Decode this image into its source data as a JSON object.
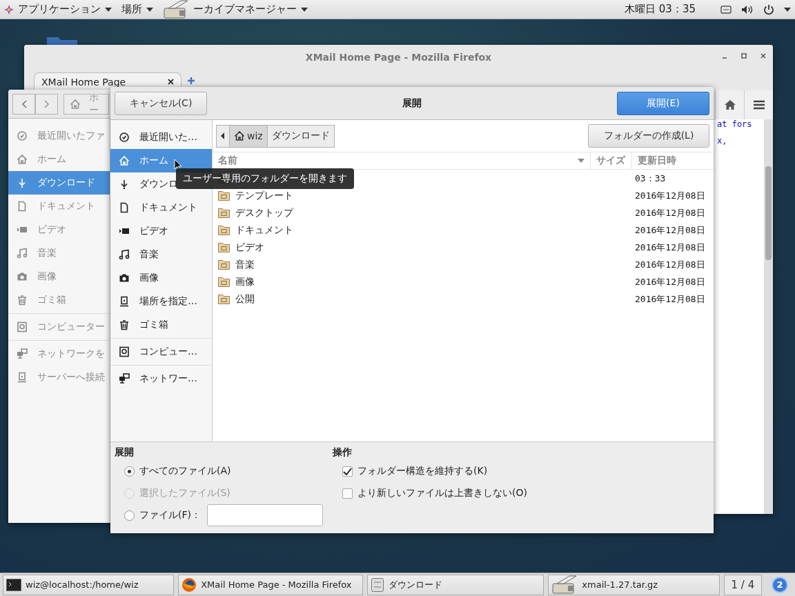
{
  "top_bar": {
    "menus": [
      {
        "label": "アプリケーション",
        "kind": "apps"
      },
      {
        "label": "場所"
      },
      {
        "label": "ーカイブマネージャー",
        "kind": "archive"
      }
    ],
    "clock": "木曜日 03：35"
  },
  "browser": {
    "title": "XMail Home Page - Mozilla Firefox",
    "tab": "XMail Home Page",
    "page_text": [
      "at fors",
      "x,"
    ]
  },
  "file_manager": {
    "path": "ホー",
    "sidebar": [
      {
        "items": [
          {
            "label": "最近開いたファ",
            "kind": "recent",
            "selected": false
          },
          {
            "label": "ホーム",
            "kind": "home",
            "selected": false
          },
          {
            "label": "ダウンロード",
            "kind": "download",
            "selected": true
          },
          {
            "label": "ドキュメント",
            "kind": "document",
            "selected": false
          },
          {
            "label": "ビデオ",
            "kind": "video",
            "selected": false
          },
          {
            "label": "音楽",
            "kind": "music",
            "selected": false
          },
          {
            "label": "画像",
            "kind": "picture",
            "selected": false
          },
          {
            "label": "ゴミ箱",
            "kind": "trash",
            "selected": false
          }
        ]
      },
      {
        "items": [
          {
            "label": "コンピューター",
            "kind": "computer",
            "selected": false
          }
        ]
      },
      {
        "items": [
          {
            "label": "ネットワークを",
            "kind": "network",
            "selected": false
          },
          {
            "label": "サーバーへ接続",
            "kind": "location",
            "selected": false
          }
        ]
      }
    ]
  },
  "dialog": {
    "title": "展開",
    "cancel": "キャンセル(C)",
    "confirm": "展開(E)",
    "sidebar": [
      {
        "items": [
          {
            "label": "最近開いた…",
            "kind": "recent",
            "selected": false
          },
          {
            "label": "ホーム",
            "kind": "home",
            "selected": true
          },
          {
            "label": "ダウンロ",
            "kind": "download",
            "selected": false
          },
          {
            "label": "ドキュメント",
            "kind": "document",
            "selected": false
          },
          {
            "label": "ビデオ",
            "kind": "video",
            "selected": false
          },
          {
            "label": "音楽",
            "kind": "music",
            "selected": false
          },
          {
            "label": "画像",
            "kind": "picture",
            "selected": false
          },
          {
            "label": "場所を指定…",
            "kind": "location",
            "selected": false
          },
          {
            "label": "ゴミ箱",
            "kind": "trash",
            "selected": false
          }
        ]
      },
      {
        "items": [
          {
            "label": "コンピュー…",
            "kind": "computer",
            "selected": false
          }
        ]
      },
      {
        "items": [
          {
            "label": "ネットワー…",
            "kind": "network",
            "selected": false
          }
        ]
      }
    ],
    "breadcrumb": [
      {
        "label": "wiz",
        "kind": "home",
        "selected": true
      },
      {
        "label": "ダウンロード",
        "selected": false
      }
    ],
    "new_folder": "フォルダーの作成(L)",
    "columns": [
      "名前",
      "サイズ",
      "更新日時"
    ],
    "rows": [
      {
        "modified": "03：33"
      },
      {
        "name": "テンプレート",
        "modified": "2016年12月08日"
      },
      {
        "name": "デスクトップ",
        "modified": "2016年12月08日"
      },
      {
        "name": "ドキュメント",
        "modified": "2016年12月08日"
      },
      {
        "name": "ビデオ",
        "modified": "2016年12月08日"
      },
      {
        "name": "音楽",
        "modified": "2016年12月08日"
      },
      {
        "name": "画像",
        "modified": "2016年12月08日"
      },
      {
        "name": "公開",
        "modified": "2016年12月08日"
      }
    ],
    "tooltip": "ユーザー専用のフォルダーを開きます",
    "extract": {
      "heading": "展開",
      "options": [
        {
          "label": "すべてのファイル(A)",
          "selected": true,
          "disabled": false,
          "kind": "plain"
        },
        {
          "label": "選択したファイル(S)",
          "selected": false,
          "disabled": true,
          "kind": "plain"
        },
        {
          "label": "ファイル(F)：",
          "selected": false,
          "disabled": false,
          "kind": "field"
        }
      ]
    },
    "actions": {
      "heading": "操作",
      "options": [
        {
          "label": "フォルダー構造を維持する(K)",
          "checked": true
        },
        {
          "label": "より新しいファイルは上書きしない(O)",
          "checked": false
        }
      ]
    }
  },
  "taskbar": {
    "items": [
      {
        "label": "wiz@localhost:/home/wiz",
        "kind": "terminal"
      },
      {
        "label": "XMail Home Page - Mozilla Firefox",
        "kind": "globe"
      },
      {
        "label": "ダウンロード",
        "kind": "files"
      },
      {
        "label": "xmail-1.27.tar.gz",
        "kind": "archive"
      }
    ],
    "workspace": "1 / 4",
    "notifications": "2"
  }
}
